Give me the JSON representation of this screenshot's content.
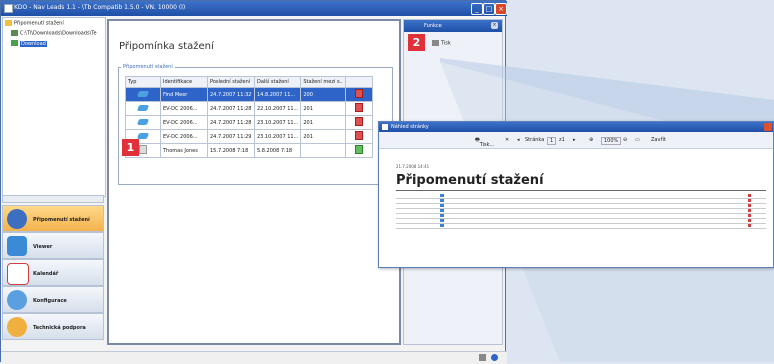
{
  "window": {
    "title": "KDO - Nav Leads 1.1 - \\Tb Compatib 1.5.0 - VN. 10000 (I)"
  },
  "tree": {
    "items": [
      {
        "label": "Připomenutí stažení"
      },
      {
        "label": "C:\\Tl\\Downloads\\Downloads\\Te"
      },
      {
        "label": "Download"
      }
    ]
  },
  "nav": {
    "items": [
      {
        "label": "Připomenutí stažení",
        "active": true
      },
      {
        "label": "Viewer",
        "active": false
      },
      {
        "label": "Kalendář",
        "active": false
      },
      {
        "label": "Konfigurace",
        "active": false
      },
      {
        "label": "Technická podpora",
        "active": false
      }
    ]
  },
  "content": {
    "title": "Připomínka stažení",
    "group_label": "Připomenutí stažení",
    "columns": [
      "Typ",
      "Identifikace",
      "Poslední stažení",
      "Další stažení",
      "Stažení mezi s..",
      ""
    ],
    "rows": [
      {
        "type": "dl",
        "id": "Find Meer",
        "last": "24.7.2007 11:32",
        "next": "14.8.2007 11...",
        "between": "200",
        "action": "del",
        "selected": true
      },
      {
        "type": "dl",
        "id": "EV-DC 2006...",
        "last": "24.7.2007 11:28",
        "next": "22.10.2007 11...",
        "between": "201",
        "action": "del",
        "selected": false
      },
      {
        "type": "dl",
        "id": "EV-DC 2006...",
        "last": "24.7.2007 11:28",
        "next": "23.10.2007 11...",
        "between": "201",
        "action": "del",
        "selected": false
      },
      {
        "type": "dl",
        "id": "EV-DC 2006...",
        "last": "24.7.2007 11:29",
        "next": "23.10.2007 11...",
        "between": "201",
        "action": "del",
        "selected": false
      },
      {
        "type": "doc",
        "id": "Thomas Jones",
        "last": "15.7.2008 7:18",
        "next": "5.8.2008 7:18",
        "between": "",
        "action": "ok",
        "selected": false
      }
    ]
  },
  "right_panel": {
    "title": "Funkce",
    "item": "Tisk"
  },
  "badges": {
    "one": "1",
    "two": "2"
  },
  "preview": {
    "title": "Náhled stránky",
    "toolbar": {
      "print": "Tisk...",
      "page_label": "Stránka",
      "page": "1",
      "of": "z1",
      "zoom": "100%",
      "close": "Zavřít"
    },
    "date": "21.7.2008 14:41",
    "heading": "Připomenutí stažení",
    "row_count": 7
  }
}
